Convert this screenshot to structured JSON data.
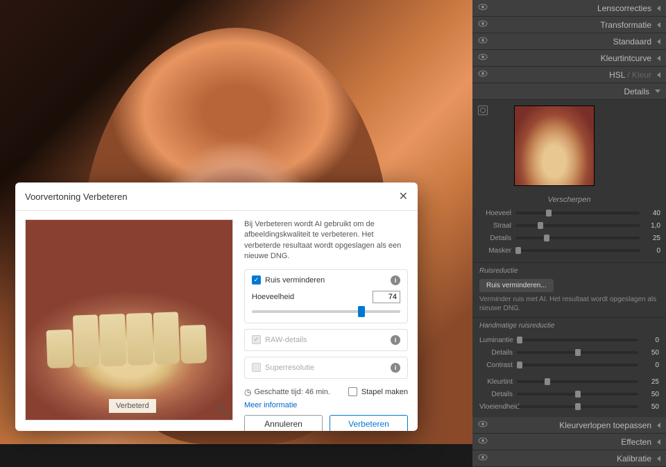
{
  "panels": {
    "lens": "Lenscorrecties",
    "transform": "Transformatie",
    "standard": "Standaard",
    "tonecurve": "Kleurtintcurve",
    "hsl": "HSL",
    "hsl_dim": " / Kleur",
    "details": "Details",
    "gradients": "Kleurverlopen toepassen",
    "effects": "Effecten",
    "calibration": "Kalibratie"
  },
  "sharpen": {
    "header": "Verscherpen",
    "amount": {
      "lbl": "Hoeveel",
      "val": "40"
    },
    "radius": {
      "lbl": "Straal",
      "val": "1,0"
    },
    "detail": {
      "lbl": "Details",
      "val": "25"
    },
    "mask": {
      "lbl": "Masker",
      "val": "0"
    }
  },
  "noise": {
    "header": "Ruisreductie",
    "btn": "Ruis verminderen...",
    "note": "Verminder ruis met AI. Het resultaat wordt opgeslagen als nieuwe DNG."
  },
  "manual": {
    "header": "Handmatige ruisreductie",
    "lum": {
      "lbl": "Luminantie",
      "val": "0"
    },
    "lumdetail": {
      "lbl": "Details",
      "val": "50"
    },
    "lumcontrast": {
      "lbl": "Contrast",
      "val": "0"
    },
    "color": {
      "lbl": "Kleurtint",
      "val": "25"
    },
    "coldetail": {
      "lbl": "Details",
      "val": "50"
    },
    "colsmooth": {
      "lbl": "Vloeiendheid",
      "val": "50"
    }
  },
  "dialog": {
    "title": "Voorvertoning Verbeteren",
    "desc": "Bij Verbeteren wordt AI gebruikt om de afbeeldingskwaliteit te verbeteren. Het verbeterde resultaat wordt opgeslagen als een nieuwe DNG.",
    "denoise": "Ruis verminderen",
    "amount_lbl": "Hoeveelheid",
    "amount_val": "74",
    "raw": "RAW-details",
    "super": "Superresolutie",
    "time": "Geschatte tijd: 46 min.",
    "stack": "Stapel maken",
    "more": "Meer informatie",
    "badge": "Verbeterd",
    "cancel": "Annuleren",
    "enhance": "Verbeteren"
  }
}
